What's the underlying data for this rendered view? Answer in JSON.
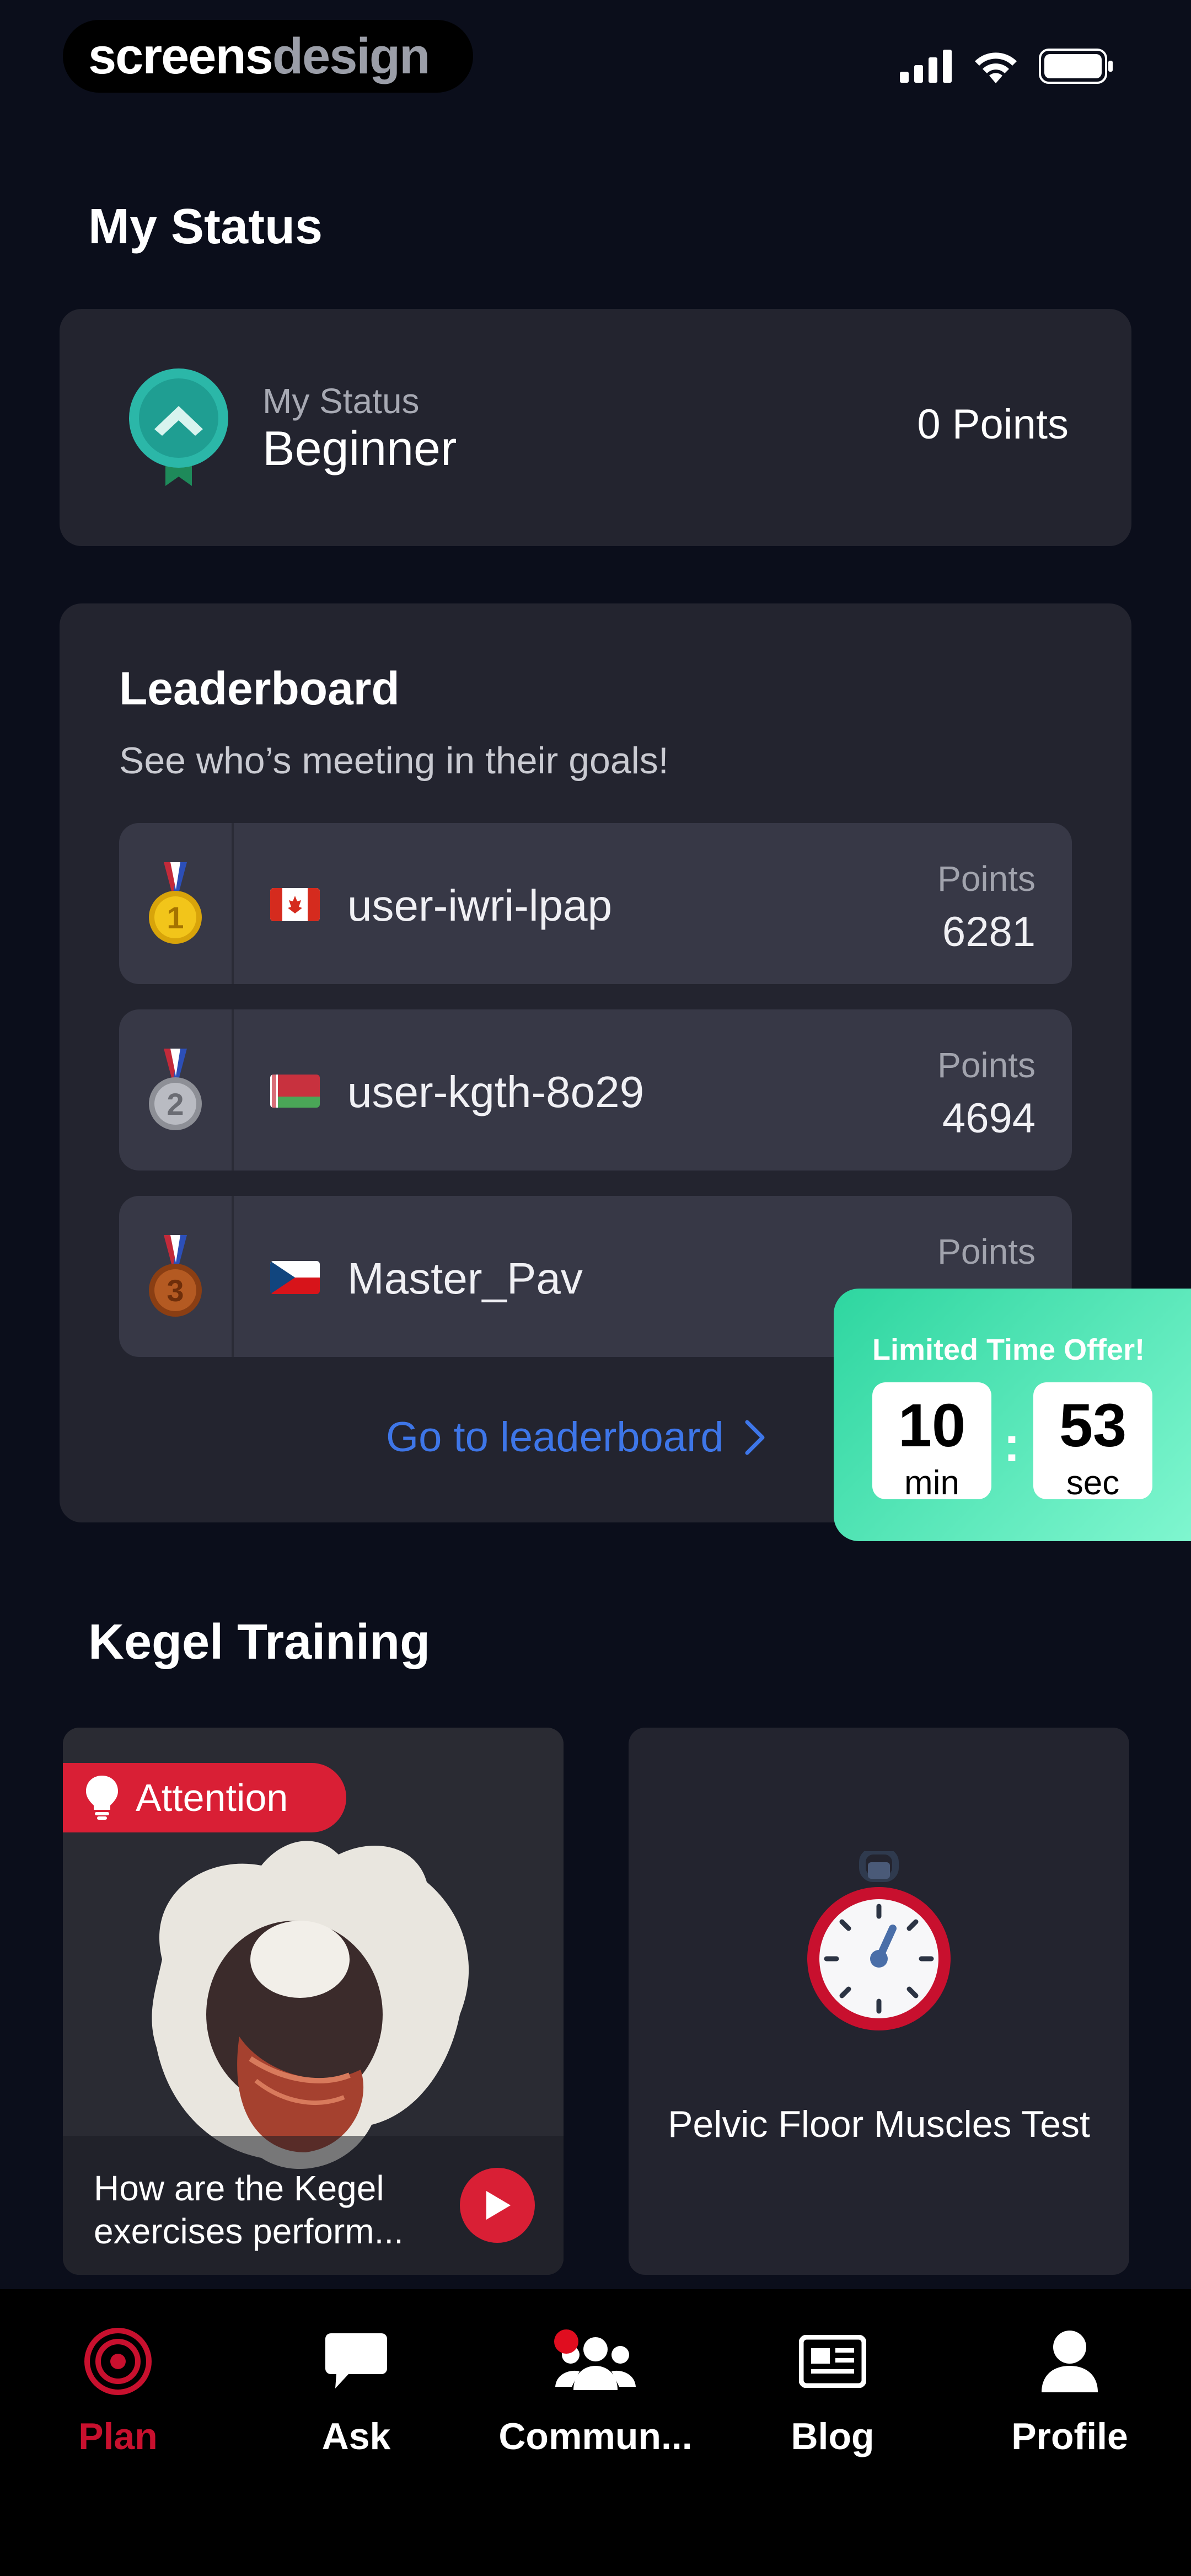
{
  "status_bar": {
    "brand_part1": "screens",
    "brand_part2": "design"
  },
  "my_status_section": {
    "title": "My Status"
  },
  "status_card": {
    "label": "My Status",
    "level": "Beginner",
    "points": "0 Points"
  },
  "leaderboard": {
    "title": "Leaderboard",
    "subtitle": "See who’s meeting in their goals!",
    "entries": [
      {
        "rank": "1",
        "country": "Canada",
        "username": "user-iwri-lpap",
        "points_label": "Points",
        "points": "6281"
      },
      {
        "rank": "2",
        "country": "Belarus",
        "username": "user-kgth-8o29",
        "points_label": "Points",
        "points": "4694"
      },
      {
        "rank": "3",
        "country": "Czechia",
        "username": "Master_Pav",
        "points_label": "Points",
        "points": ""
      }
    ],
    "link": "Go to leaderboard"
  },
  "offer": {
    "title": "Limited Time Offer!",
    "minutes": "10",
    "minutes_unit": "min",
    "seconds": "53",
    "seconds_unit": "sec",
    "separator": ":"
  },
  "kegel": {
    "title": "Kegel Training",
    "video_card": {
      "badge": "Attention",
      "caption": "How are the Kegel exercises perform..."
    },
    "test_card": {
      "label": "Pelvic Floor Muscles Test"
    }
  },
  "nav": {
    "items": [
      {
        "label": "Plan",
        "icon": "target-icon",
        "active": true
      },
      {
        "label": "Ask",
        "icon": "chat-bubble-icon"
      },
      {
        "label": "Commun...",
        "icon": "community-icon"
      },
      {
        "label": "Blog",
        "icon": "newspaper-icon"
      },
      {
        "label": "Profile",
        "icon": "person-icon"
      }
    ]
  },
  "colors": {
    "accent_red": "#c8102e",
    "link_blue": "#3e76e8",
    "offer_green": "#2ed6a0",
    "card_bg": "#23242f",
    "page_bg": "#0b0e1b"
  }
}
